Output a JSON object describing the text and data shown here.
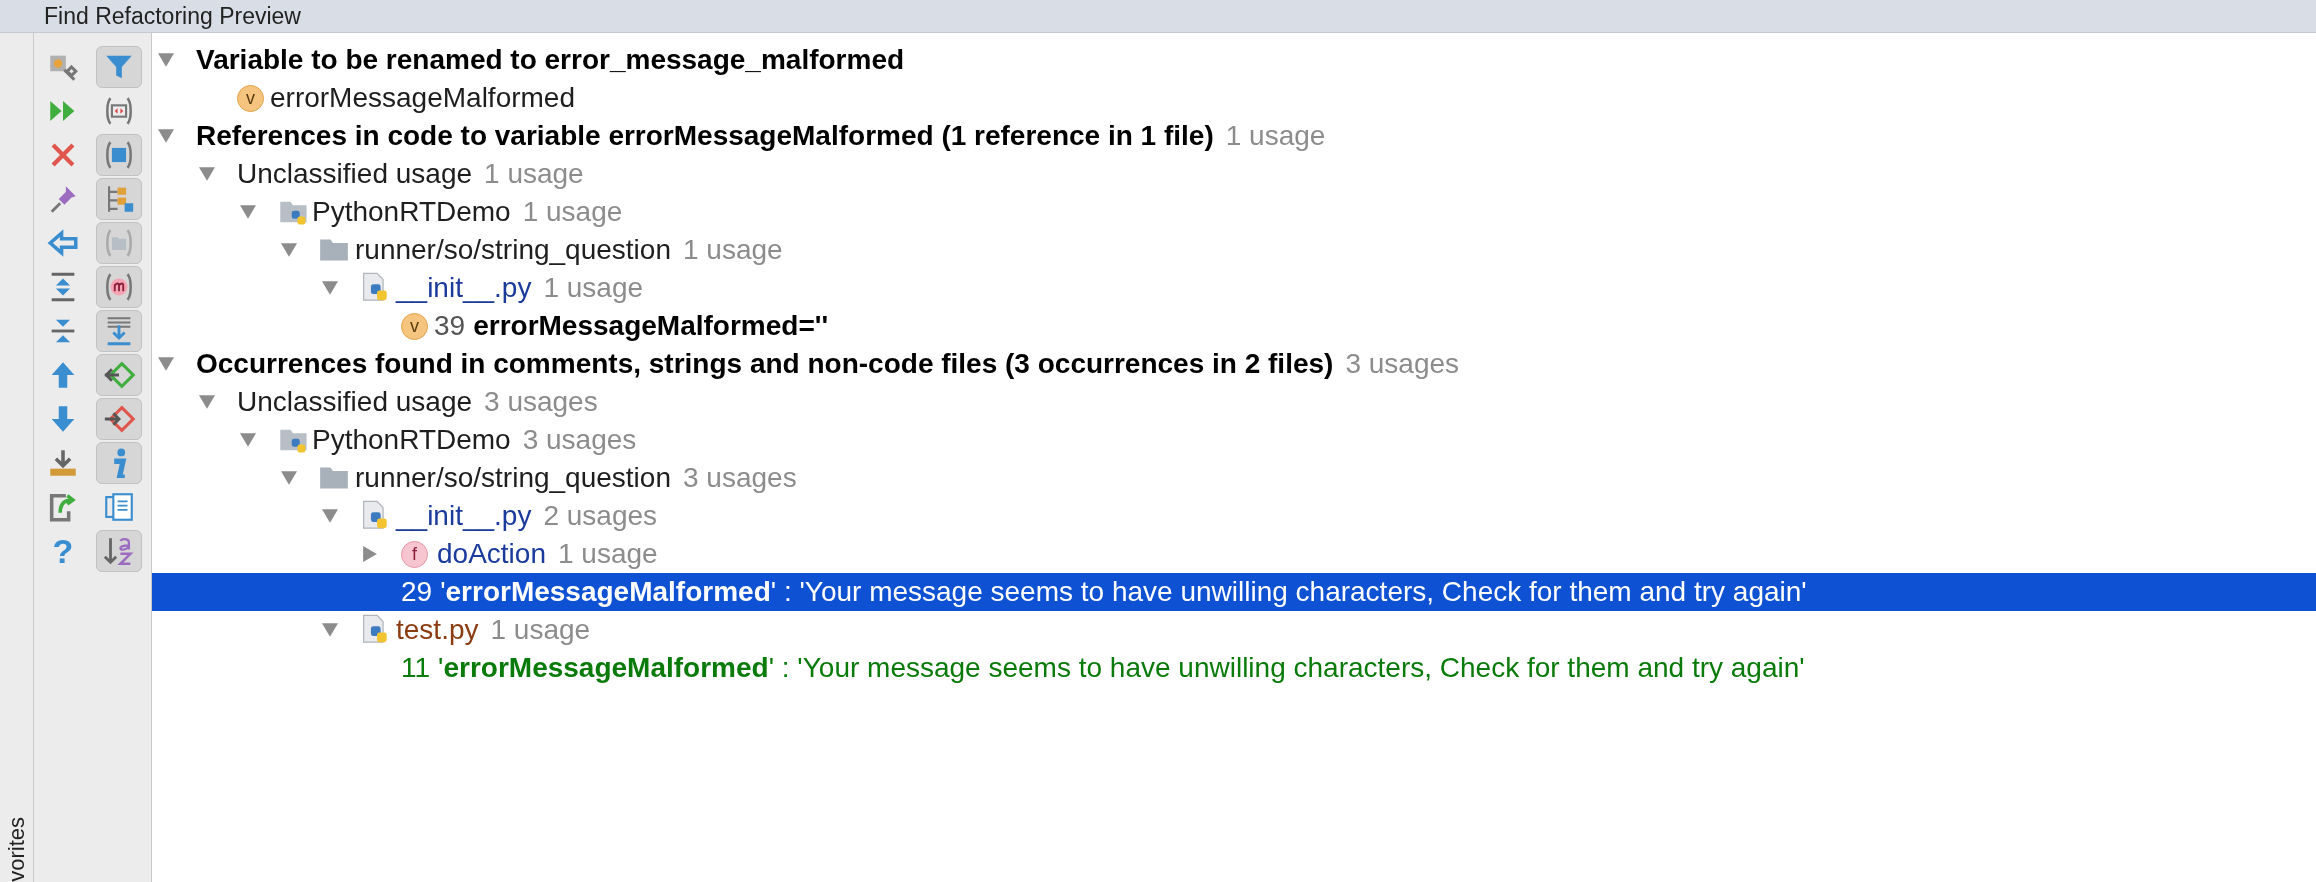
{
  "window": {
    "title": "Find Refactoring Preview"
  },
  "side_stripe": {
    "label": "vorites"
  },
  "toolbar": {
    "actions": [
      {
        "kind": "settings"
      },
      {
        "kind": "rerun"
      },
      {
        "kind": "close"
      },
      {
        "kind": "pin"
      },
      {
        "kind": "back"
      },
      {
        "kind": "expand_all"
      },
      {
        "kind": "collapse_all"
      },
      {
        "kind": "up"
      },
      {
        "kind": "down"
      },
      {
        "kind": "export"
      },
      {
        "kind": "open_external"
      },
      {
        "kind": "help",
        "label": "?"
      }
    ],
    "toggles": [
      {
        "kind": "filter",
        "on": true
      },
      {
        "kind": "code",
        "on": false
      },
      {
        "kind": "square",
        "on": true
      },
      {
        "kind": "tree",
        "on": true
      },
      {
        "kind": "folder",
        "on": true
      },
      {
        "kind": "method",
        "on": true
      },
      {
        "kind": "merge",
        "on": true
      },
      {
        "kind": "diamond_in",
        "on": true
      },
      {
        "kind": "diamond_out",
        "on": true
      },
      {
        "kind": "info",
        "on": true
      },
      {
        "kind": "preview",
        "on": false
      },
      {
        "kind": "sort",
        "on": true
      }
    ]
  },
  "tree": [
    {
      "kind": "group",
      "label": "Variable to be renamed to error_message_malformed",
      "expanded": true,
      "selected": false,
      "children": [
        {
          "kind": "variable",
          "icon_letter": "v",
          "label": "errorMessageMalformed",
          "selected": false
        }
      ]
    },
    {
      "kind": "group",
      "label": "References in code to variable errorMessageMalformed (1 reference in 1 file)",
      "count": "1 usage",
      "expanded": true,
      "selected": false,
      "children": [
        {
          "kind": "category",
          "label": "Unclassified usage",
          "count": "1 usage",
          "expanded": true,
          "selected": false,
          "children": [
            {
              "kind": "project",
              "label": "PythonRTDemo",
              "count": "1 usage",
              "expanded": true,
              "selected": false,
              "children": [
                {
                  "kind": "folder",
                  "label": "runner/so/string_question",
                  "count": "1 usage",
                  "expanded": true,
                  "selected": false,
                  "children": [
                    {
                      "kind": "file",
                      "label": "__init__.py",
                      "color": "#1a3a9c",
                      "count": "1 usage",
                      "expanded": true,
                      "selected": false,
                      "children": [
                        {
                          "kind": "usage",
                          "icon_letter": "v",
                          "line": "39",
                          "text": "errorMessageMalformed=''",
                          "bold": true,
                          "color": "#000000",
                          "selected": false
                        }
                      ]
                    }
                  ]
                }
              ]
            }
          ]
        }
      ]
    },
    {
      "kind": "group",
      "label": "Occurrences found in comments, strings and non-code files  (3 occurrences in 2 files)",
      "count": "3 usages",
      "expanded": true,
      "selected": false,
      "children": [
        {
          "kind": "category",
          "label": "Unclassified usage",
          "count": "3 usages",
          "expanded": true,
          "selected": false,
          "children": [
            {
              "kind": "project",
              "label": "PythonRTDemo",
              "count": "3 usages",
              "expanded": true,
              "selected": false,
              "children": [
                {
                  "kind": "folder",
                  "label": "runner/so/string_question",
                  "count": "3 usages",
                  "expanded": true,
                  "selected": false,
                  "children": [
                    {
                      "kind": "file",
                      "label": "__init__.py",
                      "color": "#1a3a9c",
                      "count": "2 usages",
                      "expanded": true,
                      "selected": false,
                      "children": [
                        {
                          "kind": "function",
                          "icon_letter": "f",
                          "label": "doAction",
                          "color": "#1a3a9c",
                          "count": "1 usage",
                          "expanded": false,
                          "selected": false
                        },
                        {
                          "kind": "usage",
                          "line": "29",
                          "text": "'**errorMessageMalformed**' : 'Your message seems to have unwilling characters, Check for them and try again'",
                          "bold": false,
                          "selected": true
                        }
                      ]
                    },
                    {
                      "kind": "file",
                      "label": "test.py",
                      "color": "#8a3b10",
                      "count": "1 usage",
                      "expanded": true,
                      "selected": false,
                      "children": [
                        {
                          "kind": "usage",
                          "line": "11",
                          "text": "'**errorMessageMalformed**' : 'Your message seems to have unwilling characters, Check for them and try again'",
                          "bold": false,
                          "color": "#0a7a0a",
                          "selected": false
                        }
                      ]
                    }
                  ]
                }
              ]
            }
          ]
        }
      ]
    }
  ]
}
